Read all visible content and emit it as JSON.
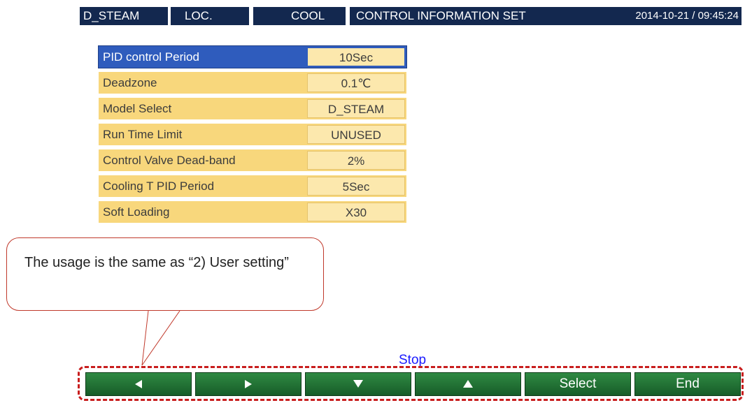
{
  "header": {
    "model": "D_STEAM",
    "location": "LOC.",
    "mode": "COOL",
    "title": "CONTROL INFORMATION SET",
    "datetime": "2014-10-21 / 09:45:24"
  },
  "settings": {
    "rows": [
      {
        "label": "PID control Period",
        "value": "10Sec",
        "selected": true
      },
      {
        "label": "Deadzone",
        "value": "0.1℃",
        "selected": false
      },
      {
        "label": "Model Select",
        "value": "D_STEAM",
        "selected": false
      },
      {
        "label": "Run Time Limit",
        "value": "UNUSED",
        "selected": false
      },
      {
        "label": "Control Valve Dead-band",
        "value": "2%",
        "selected": false
      },
      {
        "label": "Cooling T PID Period",
        "value": "5Sec",
        "selected": false
      },
      {
        "label": "Soft Loading",
        "value": "X30",
        "selected": false
      }
    ]
  },
  "callout": {
    "text": "The usage is the same as “2) User setting”",
    "border_color": "#c0392b"
  },
  "status": {
    "text": "Stop",
    "color": "#1a1aff"
  },
  "buttons": {
    "left_icon": "triangle-left-icon",
    "right_icon": "triangle-right-icon",
    "down_icon": "triangle-down-icon",
    "up_icon": "triangle-up-icon",
    "select_label": "Select",
    "end_label": "End"
  },
  "colors": {
    "header_bg": "#13284f",
    "row_bg": "#f8d77c",
    "selected_row_bg": "#2f5cbd",
    "button_bg": "#175c28",
    "highlight_frame": "#c81e1e"
  }
}
